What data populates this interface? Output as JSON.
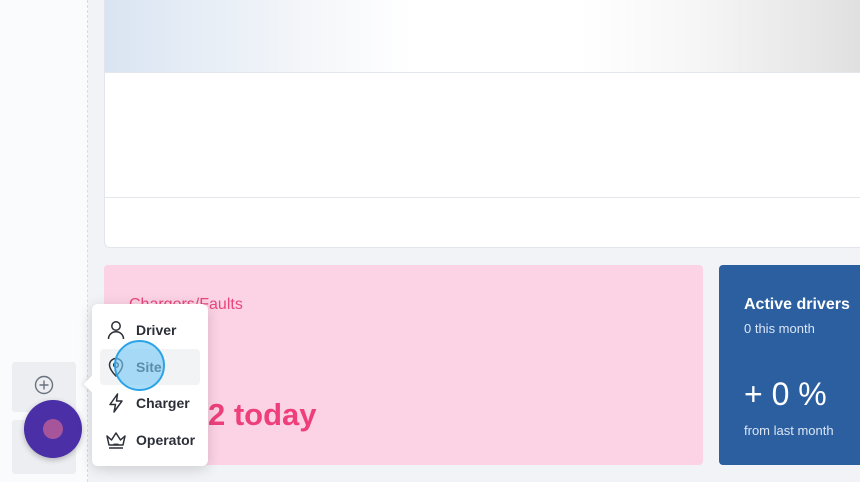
{
  "stats": {
    "faults": {
      "title": "Chargers/Faults",
      "today": "2 today",
      "accent": "#ee3f7b"
    },
    "active_drivers": {
      "title": "Active drivers",
      "subtitle": "0 this month",
      "change": "+ 0 %",
      "footer": "from last month",
      "accent": "#2b5fa0"
    }
  },
  "add_menu": {
    "items": [
      {
        "label": "Driver",
        "icon": "person-icon"
      },
      {
        "label": "Site",
        "icon": "map-pin-icon"
      },
      {
        "label": "Charger",
        "icon": "lightning-icon"
      },
      {
        "label": "Operator",
        "icon": "crown-icon"
      }
    ],
    "hovered": "Site"
  },
  "sidebar": {
    "add_icon": "plus-circle-icon"
  },
  "user": {
    "avatar_color": "#4a2fa6"
  }
}
